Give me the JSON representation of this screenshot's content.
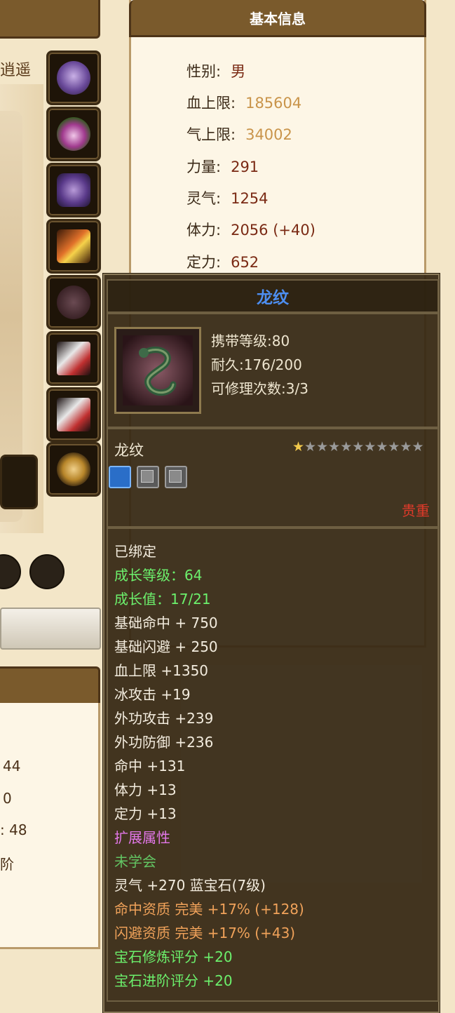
{
  "left_panel": {
    "name_fragment": "逍遥",
    "values": [
      "44",
      "0",
      ":  48",
      "阶"
    ]
  },
  "info": {
    "header": "基本信息",
    "rows": [
      {
        "label": "性别:",
        "value": "男"
      },
      {
        "label": "血上限:",
        "value": "185604"
      },
      {
        "label": "气上限:",
        "value": "34002"
      },
      {
        "label": "力量:",
        "value": "291"
      },
      {
        "label": "灵气:",
        "value": "1254"
      },
      {
        "label": "体力:",
        "value": "2056 (+40)"
      },
      {
        "label": "定力:",
        "value": "652"
      }
    ]
  },
  "tooltip": {
    "title": "龙纹",
    "carry_level": "携带等级:80",
    "durability": "耐久:176/200",
    "repair": "可修理次数:3/3",
    "name": "龙纹",
    "stars_total": 11,
    "stars_lit": 1,
    "rarity": "贵重",
    "lines": [
      {
        "text": "已绑定",
        "color": "white"
      },
      {
        "text": "成长等级：64",
        "color": "green"
      },
      {
        "text": "成长值：17/21",
        "color": "green"
      },
      {
        "text": "基础命中 + 750",
        "color": "white"
      },
      {
        "text": "基础闪避 + 250",
        "color": "white"
      },
      {
        "text": "血上限 +1350",
        "color": "white"
      },
      {
        "text": "冰攻击 +19",
        "color": "white"
      },
      {
        "text": "外功攻击 +239",
        "color": "white"
      },
      {
        "text": "外功防御 +236",
        "color": "white"
      },
      {
        "text": "命中 +131",
        "color": "white"
      },
      {
        "text": "体力 +13",
        "color": "white"
      },
      {
        "text": "定力 +13",
        "color": "white"
      },
      {
        "text": "扩展属性",
        "color": "pink"
      },
      {
        "text": "未学会",
        "color": "dgreen"
      },
      {
        "text": "灵气 +270 蓝宝石(7级)",
        "color": "white"
      },
      {
        "text": "命中资质 完美 +17% (+128)",
        "color": "orange"
      },
      {
        "text": "闪避资质 完美 +17% (+43)",
        "color": "orange"
      },
      {
        "text": "宝石修炼评分 +20",
        "color": "green"
      },
      {
        "text": "宝石进阶评分 +20",
        "color": "green"
      }
    ]
  },
  "equipment_icons": [
    "ring-icon",
    "amulet-icon",
    "helmet-icon",
    "weapon-icon",
    "dragon-emblem-icon",
    "charm-icon",
    "charm-icon",
    "mask-icon"
  ],
  "colors": {
    "header_brown": "#7a5a2c",
    "title_blue": "#4d8ef0",
    "gold_value": "#c9944a",
    "rarity_red": "#e03a2a"
  }
}
